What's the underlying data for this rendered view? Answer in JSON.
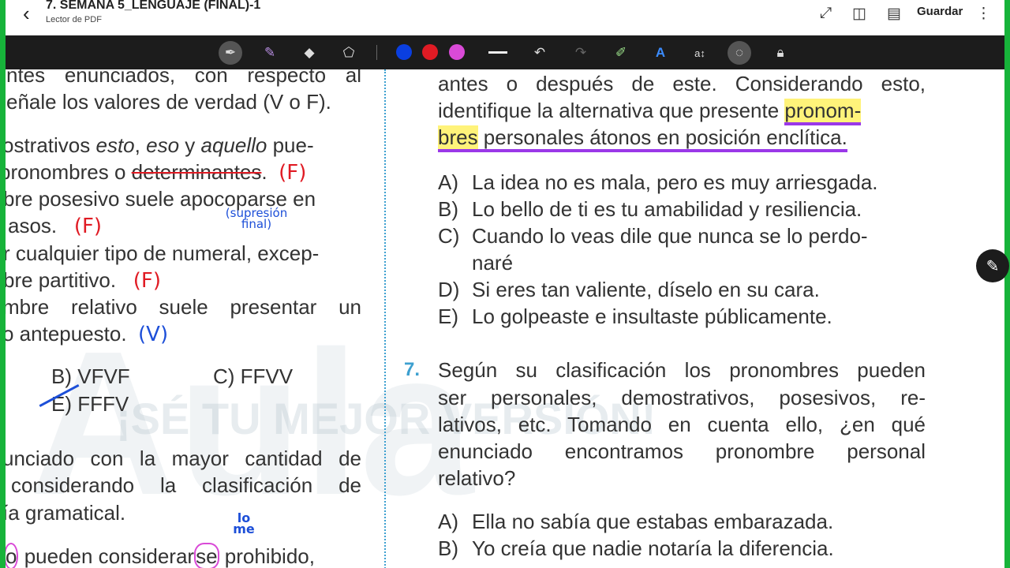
{
  "header": {
    "title": "7. SEMANA 5_LENGUAJE (FINAL)-1",
    "subtitle": "Lector de PDF",
    "save_label": "Guardar",
    "back_icon": "‹",
    "icons": {
      "expand": "⤢",
      "book": "◫",
      "doc": "▤",
      "more": "⋮"
    }
  },
  "toolbar": {
    "tools": [
      "pen",
      "highlighter",
      "eraser",
      "lasso",
      "undo",
      "redo",
      "marker",
      "text-style",
      "text-size",
      "shapes",
      "lock"
    ],
    "colors": [
      "#0a3fe0",
      "#e01b24",
      "#d94ad7"
    ]
  },
  "left": {
    "lines": [
      "ntes enunciados, con respecto al",
      "eñale los valores de verdad (V o F).",
      "ostrativos",
      "pronombres o",
      "bre posesivo suele apocoparse en",
      "asos.",
      "r cualquier tipo de numeral, excep-",
      "bre partitivo.",
      "mbre relativo suele presentar un",
      "o antepuesto."
    ],
    "line3_parts": {
      "a": "esto",
      "b": ", ",
      "c": "eso",
      "d": " y ",
      "e": "aquello",
      "f": " pue-"
    },
    "struck": "determinantes",
    "period": ".",
    "annotations": {
      "f1": "(F)",
      "f2": "(F)",
      "f3": "(F)",
      "v1": "(V)",
      "sup": "(supresión final)",
      "lome": "lo me"
    },
    "options": {
      "b": "B)  VFVF",
      "c": "C)  FFVV",
      "e": "E)  FFFV"
    },
    "q_lines": [
      "unciado con la mayor cantidad de",
      "considerando la clasificación de",
      "ía gramatical."
    ],
    "last": {
      "a": "o",
      "b": " pueden considerar",
      "c": "se",
      "d": " prohibido,"
    }
  },
  "right": {
    "intro": [
      "antes o después de este. Considerando esto,",
      "identifique la alternativa que presente"
    ],
    "hl": {
      "a": "pronom-",
      "b": "bres",
      "c": " personales átonos en posición enclítica."
    },
    "q6_options": [
      {
        "letter": "A)",
        "text": "La idea no es mala, pero es muy arriesgada."
      },
      {
        "letter": "B)",
        "text": "Lo bello de ti es tu amabilidad y resiliencia."
      },
      {
        "letter": "C)",
        "text": "Cuando lo veas dile que nunca se lo perdo-"
      },
      {
        "letter": "",
        "text": "naré"
      },
      {
        "letter": "D)",
        "text": "Si eres tan valiente, díselo en su cara."
      },
      {
        "letter": "E)",
        "text": "Lo golpeaste e insultaste públicamente."
      }
    ],
    "q7_num": "7.",
    "q7_lines": [
      "Según su clasificación los pronombres pueden",
      "ser personales, demostrativos, posesivos, re-",
      "lativos, etc. Tomando en cuenta ello, ¿en qué",
      "enunciado encontramos pronombre personal",
      "relativo?"
    ],
    "q7_options": [
      {
        "letter": "A)",
        "text": "Ella no sabía que estabas embarazada."
      },
      {
        "letter": "B)",
        "text": "Yo creía que nadie notaría la diferencia."
      }
    ]
  },
  "watermark": {
    "text": "¡SÉ TU MEJOR VERSIÓN!",
    "logo": "Aula"
  }
}
